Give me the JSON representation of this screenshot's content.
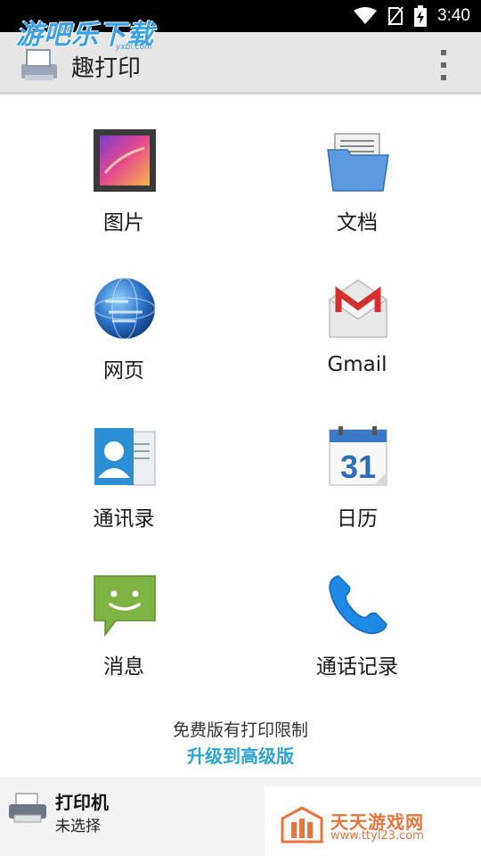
{
  "status_bar": {
    "time": "3:40"
  },
  "watermark": {
    "text": "游吧乐下载",
    "sub": "yxbl.com"
  },
  "app_bar": {
    "title": "趣打印"
  },
  "grid": [
    {
      "label": "图片",
      "icon": "photo-icon"
    },
    {
      "label": "文档",
      "icon": "folder-icon"
    },
    {
      "label": "网页",
      "icon": "globe-icon"
    },
    {
      "label": "Gmail",
      "icon": "gmail-icon"
    },
    {
      "label": "通讯录",
      "icon": "contacts-icon"
    },
    {
      "label": "日历",
      "icon": "calendar-icon",
      "day": "31"
    },
    {
      "label": "消息",
      "icon": "message-icon"
    },
    {
      "label": "通话记录",
      "icon": "phone-icon"
    }
  ],
  "notice": {
    "limit": "免费版有打印限制",
    "upgrade": "升级到高级版"
  },
  "printer": {
    "title": "打印机",
    "status": "未选择"
  },
  "ad": {
    "title": "天天游戏网",
    "url": "www.ttyl23.com"
  },
  "colors": {
    "link": "#2aa3d6",
    "app_bar": "#e6e6e6",
    "ad": "#e8743b"
  }
}
